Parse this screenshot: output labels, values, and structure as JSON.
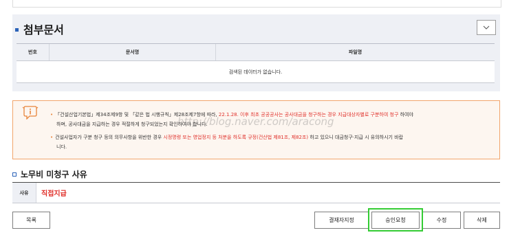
{
  "attachments": {
    "title": "첨부문서",
    "columns": [
      "번호",
      "문서명",
      "파일명"
    ],
    "empty_message": "검색된 데이터가 없습니다."
  },
  "notice": {
    "line1_a": "「건설산업기본법」제34조제9항 및 「같은 법 시행규칙」제28조제7항에 따라, ",
    "line1_red": "22.1.28. 이후 최초 공공공사는 공사대금을 청구하는 경우 지급대상자별로 구분하여 청구",
    "line1_b": " 하여야",
    "line2": "하며, 공사대금을 지급하는 경우 적절하게 청구되었는지 확인하여야 합니다.",
    "line3_a": "건설사업자가 구분 청구 등의 의무사항을 위반한 경우 ",
    "line3_red": "시정명령 또는 영업정지 등 처분을 하도록 규정(건산법 제81조, 제82조)",
    "line3_b": " 하고 있으니 대금청구·지급 시 유의하시기 바랍",
    "line4": "니다.",
    "watermark": "http://blog.naver.com/aracong"
  },
  "labor": {
    "title": "노무비 미청구 사유",
    "reason_label": "사유",
    "reason_value": "직접지급"
  },
  "buttons": {
    "list": "목록",
    "approver": "결재자지정",
    "request_approval": "승인요청",
    "edit": "수정",
    "delete": "삭제"
  },
  "icons": {
    "toggle": "chevron-down-icon",
    "notice": "info-speech-icon"
  },
  "colors": {
    "accent_blue": "#2a62b8",
    "warning_red": "#e0302a",
    "notice_border": "#f2a46a",
    "highlight_green": "#33cc33"
  }
}
